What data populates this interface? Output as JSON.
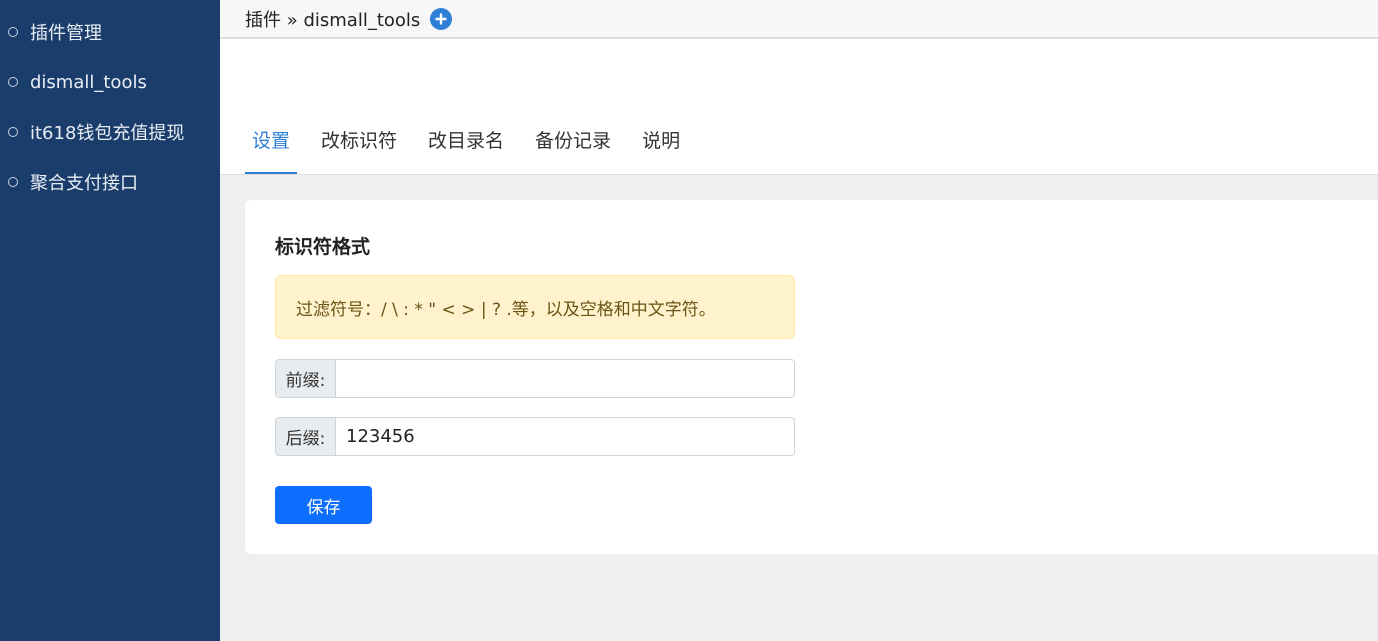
{
  "sidebar": {
    "items": [
      {
        "label": "插件管理"
      },
      {
        "label": "dismall_tools"
      },
      {
        "label": "it618钱包充值提现"
      },
      {
        "label": "聚合支付接口"
      }
    ]
  },
  "breadcrumb": {
    "text": "插件 » dismall_tools",
    "add_icon": "plus-circle-icon"
  },
  "tabs": [
    {
      "label": "设置",
      "active": true
    },
    {
      "label": "改标识符",
      "active": false
    },
    {
      "label": "改目录名",
      "active": false
    },
    {
      "label": "备份记录",
      "active": false
    },
    {
      "label": "说明",
      "active": false
    }
  ],
  "form": {
    "title": "标识符格式",
    "alert": "过滤符号：/ \\ : * \" < > | ? .等，以及空格和中文字符。",
    "prefix_label": "前缀:",
    "prefix_value": "",
    "suffix_label": "后缀:",
    "suffix_value": "123456",
    "save_label": "保存"
  },
  "colors": {
    "sidebar_bg": "#1a3d6b",
    "accent": "#2f7fd6",
    "button": "#0d6efd",
    "alert_bg": "#fff3cd"
  }
}
